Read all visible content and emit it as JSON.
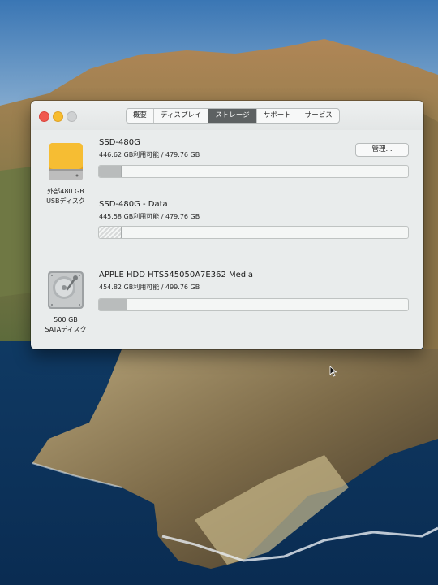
{
  "window": {
    "tabs": [
      {
        "label": "概要",
        "active": false
      },
      {
        "label": "ディスプレイ",
        "active": false
      },
      {
        "label": "ストレージ",
        "active": true
      },
      {
        "label": "サポート",
        "active": false
      },
      {
        "label": "サービス",
        "active": false
      }
    ],
    "manage_button": "管理..."
  },
  "devices": [
    {
      "icon": "external-usb-drive-icon",
      "caption_line1": "外部480 GB",
      "caption_line2": "USBディスク",
      "volumes": [
        {
          "name": "SSD-480G",
          "space": "446.62 GB利用可能 / 479.76 GB",
          "used_fraction": 0.07
        },
        {
          "name": "SSD-480G - Data",
          "space": "445.58 GB利用可能 / 479.76 GB",
          "used_fraction": 0.07
        }
      ]
    },
    {
      "icon": "internal-hdd-icon",
      "caption_line1": "500 GB",
      "caption_line2": "SATAディスク",
      "volumes": [
        {
          "name": "APPLE HDD HTS545050A7E362 Media",
          "space": "454.82 GB利用可能 / 499.76 GB",
          "used_fraction": 0.09
        }
      ]
    }
  ],
  "colors": {
    "close": "#f0584f",
    "minimize": "#f7bc2e",
    "zoom": "#cfd1d2",
    "active_tab": "#5d6162",
    "usb_drive": "#f3b52a"
  }
}
